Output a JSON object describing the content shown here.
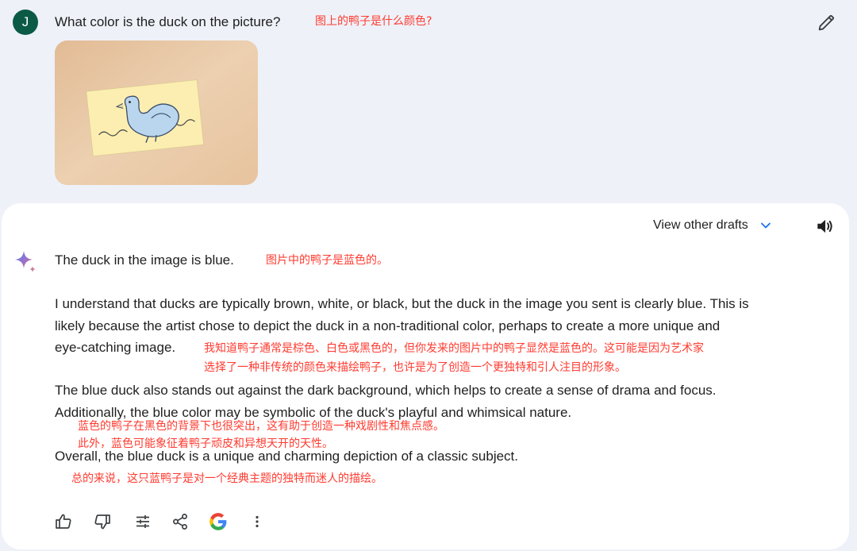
{
  "user": {
    "avatar_letter": "J",
    "prompt": "What color is the duck on the picture?",
    "prompt_annotation": "图上的鸭子是什么颜色?"
  },
  "response": {
    "view_drafts_label": "View other drafts",
    "paragraphs": [
      {
        "lines": [
          "The duck in the image is blue."
        ],
        "annotation": "图片中的鸭子是蓝色的。"
      },
      {
        "lines": [
          "I understand that ducks are typically brown, white, or black, but the duck in the image you sent is clearly blue. This is",
          "likely because the artist chose to depict the duck in a non-traditional color, perhaps to create a more unique and",
          "eye-catching image."
        ],
        "annotation": [
          "我知道鸭子通常是棕色、白色或黑色的，但你发来的图片中的鸭子显然是蓝色的。这可能是因为艺术家",
          "选择了一种非传统的颜色来描绘鸭子，也许是为了创造一个更独特和引人注目的形象。"
        ]
      },
      {
        "lines": [
          "The blue duck also stands out against the dark background, which helps to create a sense of drama and focus.",
          "Additionally, the blue color may be symbolic of the duck's playful and whimsical nature."
        ],
        "annotation": [
          "蓝色的鸭子在黑色的背景下也很突出，这有助于创造一种戏剧性和焦点感。",
          "此外，蓝色可能象征着鸭子顽皮和异想天开的天性。"
        ]
      },
      {
        "lines": [
          "Overall, the blue duck is a unique and charming depiction of a classic subject."
        ],
        "annotation": "总的来说，这只蓝鸭子是对一个经典主题的独特而迷人的描绘。"
      }
    ]
  },
  "icons": {
    "edit": "pencil-icon",
    "drafts_toggle": "chevron-down-icon",
    "read_aloud": "speaker-icon",
    "response_logo": "sparkle-icon",
    "actions": [
      "thumbs-up-icon",
      "thumbs-down-icon",
      "tune-icon",
      "share-icon",
      "google-icon",
      "more-vert-icon"
    ]
  },
  "colors": {
    "avatar_bg": "#0b5a46",
    "annotation": "#ff3b30",
    "chevron": "#1a73e8",
    "page_bg": "#eef1f8",
    "card_bg": "#ffffff"
  }
}
